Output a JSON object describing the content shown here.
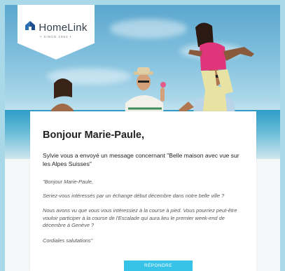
{
  "brand": {
    "name": "HomeLink",
    "tagline": "• SINCE 1953 •",
    "icon": "house-icon",
    "color": "#2c6fb3"
  },
  "email": {
    "greeting": "Bonjour Marie-Paule,",
    "intro": "Sylvie vous a envoyé un message concernant \"Belle maison avec vue sur les Alpes Suisses\"",
    "message": [
      "\"Bonjour Marie-Paule,",
      "Seriez-vous intéressés par un échange début décembre dans notre belle ville ?",
      "Nous avons vu que vous vous intéressiez à la course à pied. Vous pourriez peut-être vouloir participer à la course de l'Escalade qui aura lieu le premier week-end de décembre à Genève ?",
      "Cordiales salutations\""
    ],
    "reply_button": "RÉPONDRE"
  },
  "colors": {
    "accent": "#37c3e8",
    "frame": "#a9d8e9"
  }
}
